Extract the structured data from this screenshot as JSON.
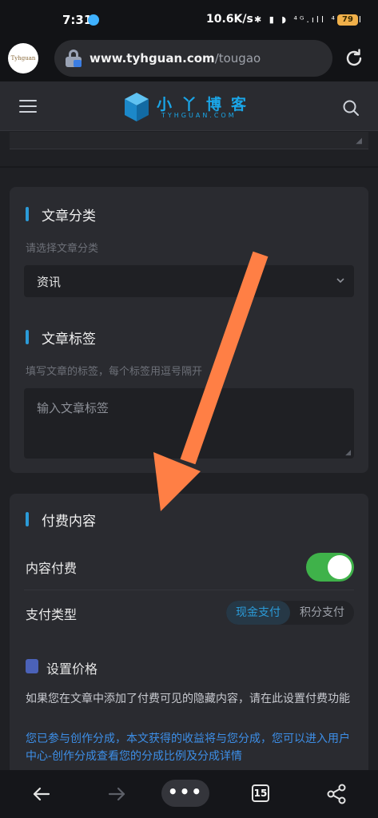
{
  "status_bar": {
    "time": "7:31",
    "network_speed": "10.6K/s",
    "signal_icons": "✱ ▮ ◗ ⁴ᴳ.ıll ⁴ᴳ.ıll",
    "battery_level": "79"
  },
  "browser": {
    "site_logo_text": "Tyhguan",
    "url_domain": "www.tyhguan.com",
    "url_path": "/tougao"
  },
  "site_header": {
    "brand_cn": "小丫博客",
    "brand_en": "TYHGUAN.COM"
  },
  "category_section": {
    "title": "文章分类",
    "hint": "请选择文章分类",
    "selected": "资讯"
  },
  "tags_section": {
    "title": "文章标签",
    "hint": "填写文章的标签，每个标签用逗号隔开",
    "placeholder": "输入文章标签"
  },
  "paid_section": {
    "title": "付费内容",
    "paid_label": "内容付费",
    "paid_enabled": true,
    "pay_type_label": "支付类型",
    "pay_options": [
      "现金支付",
      "积分支付"
    ],
    "pay_selected": "现金支付",
    "price_title": "设置价格",
    "price_desc": "如果您在文章中添加了付费可见的隐藏内容，请在此设置付费功能",
    "share_notice": "您已参与创作分成，本文获得的收益将与您分成，您可以进入用户中心-创作分成查看您的分成比例及分成详情"
  },
  "bottom_nav": {
    "more_label": "•••",
    "tab_count": "15"
  },
  "colors": {
    "accent_blue": "#2b9bd8",
    "toggle_green": "#3fb24a",
    "annotation_arrow": "#ff7f45"
  }
}
